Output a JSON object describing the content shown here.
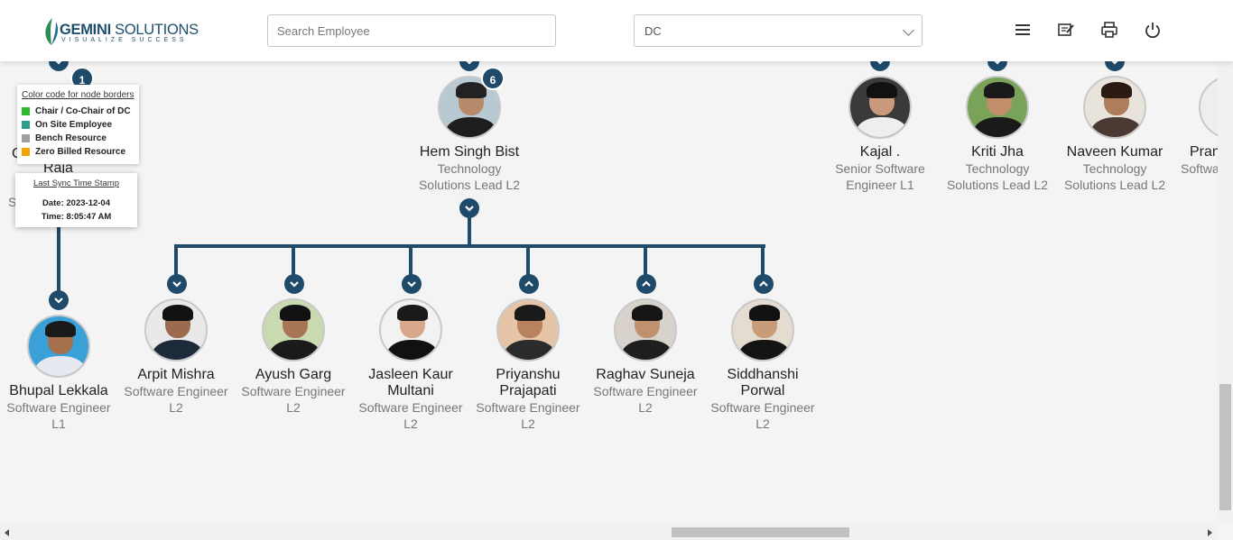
{
  "header": {
    "logo_name": "GEMINI",
    "logo_name2": "SOLUTIONS",
    "logo_tagline": "VISUALIZE SUCCESS",
    "search_placeholder": "Search Employee",
    "dc_select_value": "DC",
    "icons": [
      "menu-icon",
      "feedback-icon",
      "print-icon",
      "power-icon"
    ]
  },
  "legend": {
    "title": "Color code for node borders",
    "items": [
      {
        "label": "Chair / Co-Chair of DC",
        "color": "#2eb82e"
      },
      {
        "label": "On Site Employee",
        "color": "#2a9d8f"
      },
      {
        "label": "Bench Resource",
        "color": "#9e9e9e"
      },
      {
        "label": "Zero Billed Resource",
        "color": "#f0a500"
      }
    ]
  },
  "sync": {
    "title": "Last Sync Time Stamp",
    "date": "Date: 2023-12-04",
    "time": "Time: 8:05:47 AM"
  },
  "partial_left": {
    "badge": "1",
    "name_fragment": "Raja",
    "c_fragment": "C",
    "s_fragment": "S"
  },
  "lead": {
    "badge": "6",
    "name": "Hem Singh Bist",
    "designation_line1": "Technology",
    "designation_line2": "Solutions Lead L2"
  },
  "top_right_nodes": [
    {
      "name": "Kajal .",
      "line1": "Senior Software",
      "line2": "Engineer L1"
    },
    {
      "name": "Kriti Jha",
      "line1": "Technology",
      "line2": "Solutions Lead L2"
    },
    {
      "name": "Naveen Kumar",
      "line1": "Technology",
      "line2": "Solutions Lead L2"
    },
    {
      "name": "Pran",
      "line1": "Softwa",
      "line2": ""
    }
  ],
  "left_child": {
    "name": "Bhupal Lekkala",
    "line1": "Software Engineer",
    "line2": "L1"
  },
  "children": [
    {
      "name1": "Arpit Mishra",
      "name2": "",
      "line1": "Software Engineer",
      "line2": "L2"
    },
    {
      "name1": "Ayush Garg",
      "name2": "",
      "line1": "Software Engineer",
      "line2": "L2"
    },
    {
      "name1": "Jasleen Kaur",
      "name2": "Multani",
      "line1": "Software Engineer",
      "line2": "L2"
    },
    {
      "name1": "Priyanshu",
      "name2": "Prajapati",
      "line1": "Software Engineer",
      "line2": "L2"
    },
    {
      "name1": "Raghav Suneja",
      "name2": "",
      "line1": "Software Engineer",
      "line2": "L2"
    },
    {
      "name1": "Siddhanshi",
      "name2": "Porwal",
      "line1": "Software Engineer",
      "line2": "L2"
    }
  ]
}
